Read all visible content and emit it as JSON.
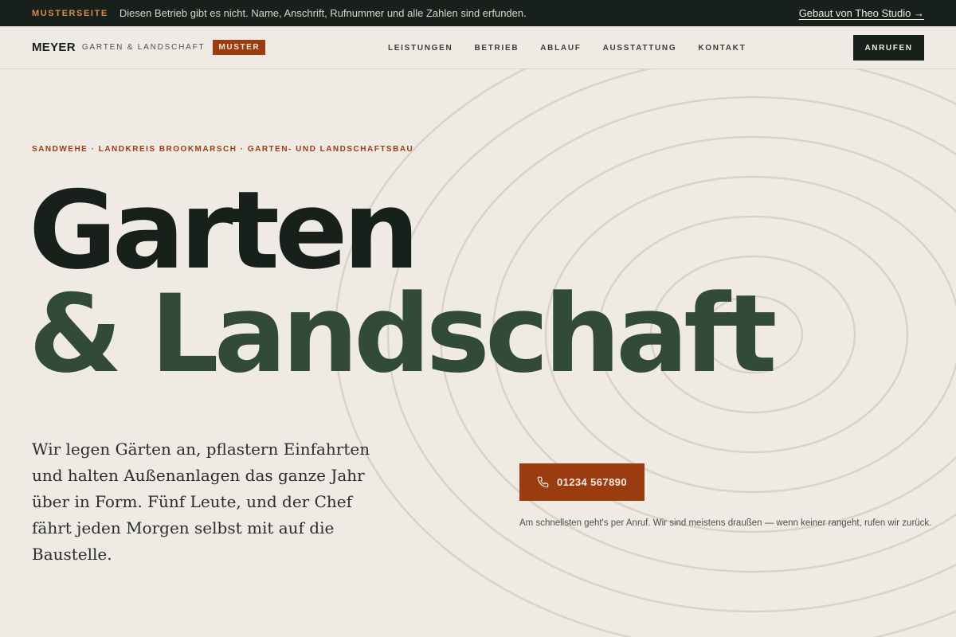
{
  "notice": {
    "tag": "MUSTERSEITE",
    "text": "Diesen Betrieb gibt es nicht. Name, Anschrift, Rufnummer und alle Zahlen sind erfunden.",
    "link": "Gebaut von Theo Studio →"
  },
  "header": {
    "brand_name": "MEYER",
    "brand_sub": "GARTEN & LANDSCHAFT",
    "badge": "MUSTER",
    "nav": [
      "LEISTUNGEN",
      "BETRIEB",
      "ABLAUF",
      "AUSSTATTUNG",
      "KONTAKT"
    ],
    "call_label": "ANRUFEN"
  },
  "hero": {
    "eyebrow": "SANDWEHE · LANDKREIS BROOKMARSCH · GARTEN- UND LANDSCHAFTSBAU",
    "headline_1": "Garten",
    "headline_2": "& Landschaft",
    "lead": "Wir legen Gärten an, pflastern Einfahrten und halten Außenanlagen das ganze Jahr über in Form. Fünf Leute, und der Chef fährt jeden Morgen selbst mit auf die Baustelle.",
    "phone_label": "01234 567890",
    "phone_icon": "phone-icon",
    "hint": "Am schnellsten geht's per Anruf. Wir sind meistens draußen — wenn keiner rangeht, rufen wir zurück."
  },
  "colors": {
    "background": "#efebe4",
    "dark": "#17201a",
    "green": "#314a3a",
    "accent": "#9a3b10",
    "eyebrow_accent": "#d98a4e"
  }
}
